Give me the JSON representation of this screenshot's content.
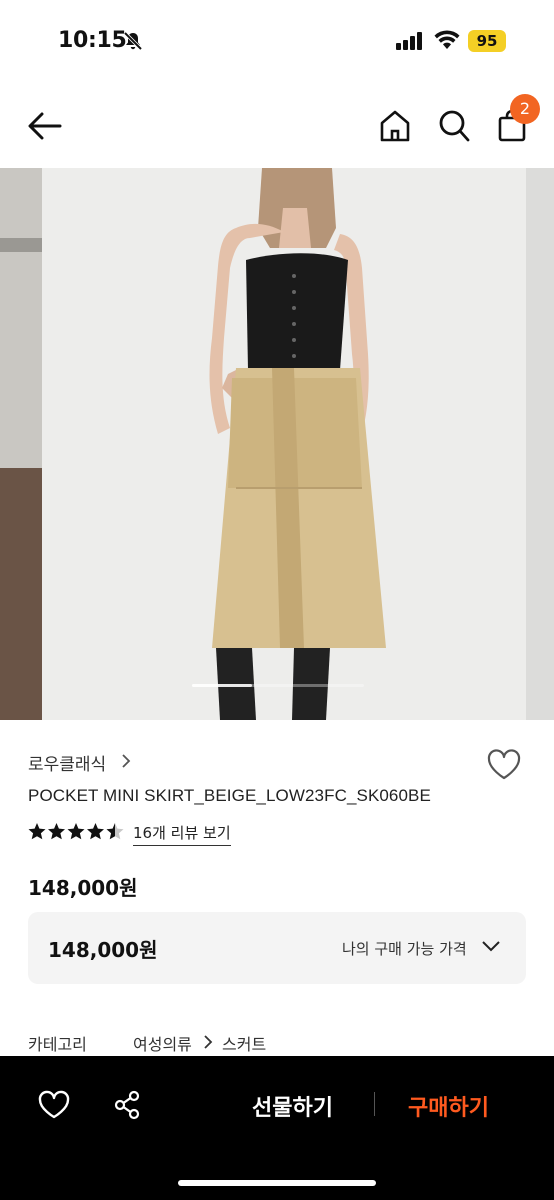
{
  "status": {
    "time": "10:15",
    "battery": "95"
  },
  "nav": {
    "cart_count": "2"
  },
  "gallery": {
    "progress": 0.35
  },
  "product": {
    "brand": "로우클래식",
    "name": "POCKET MINI SKIRT_BEIGE_LOW23FC_SK060BE",
    "rating": 4.5,
    "reviews_label": "16개 리뷰 보기",
    "price": "148,000원"
  },
  "price_box": {
    "price": "148,000원",
    "label": "나의 구매 가능 가격"
  },
  "category": {
    "label": "카테고리",
    "path": [
      "여성의류",
      "스커트"
    ]
  },
  "bottom": {
    "gift_label": "선물하기",
    "buy_label": "구매하기"
  },
  "colors": {
    "accent": "#f26522",
    "buy": "#ff5a1f",
    "battery": "#f4cf25"
  }
}
